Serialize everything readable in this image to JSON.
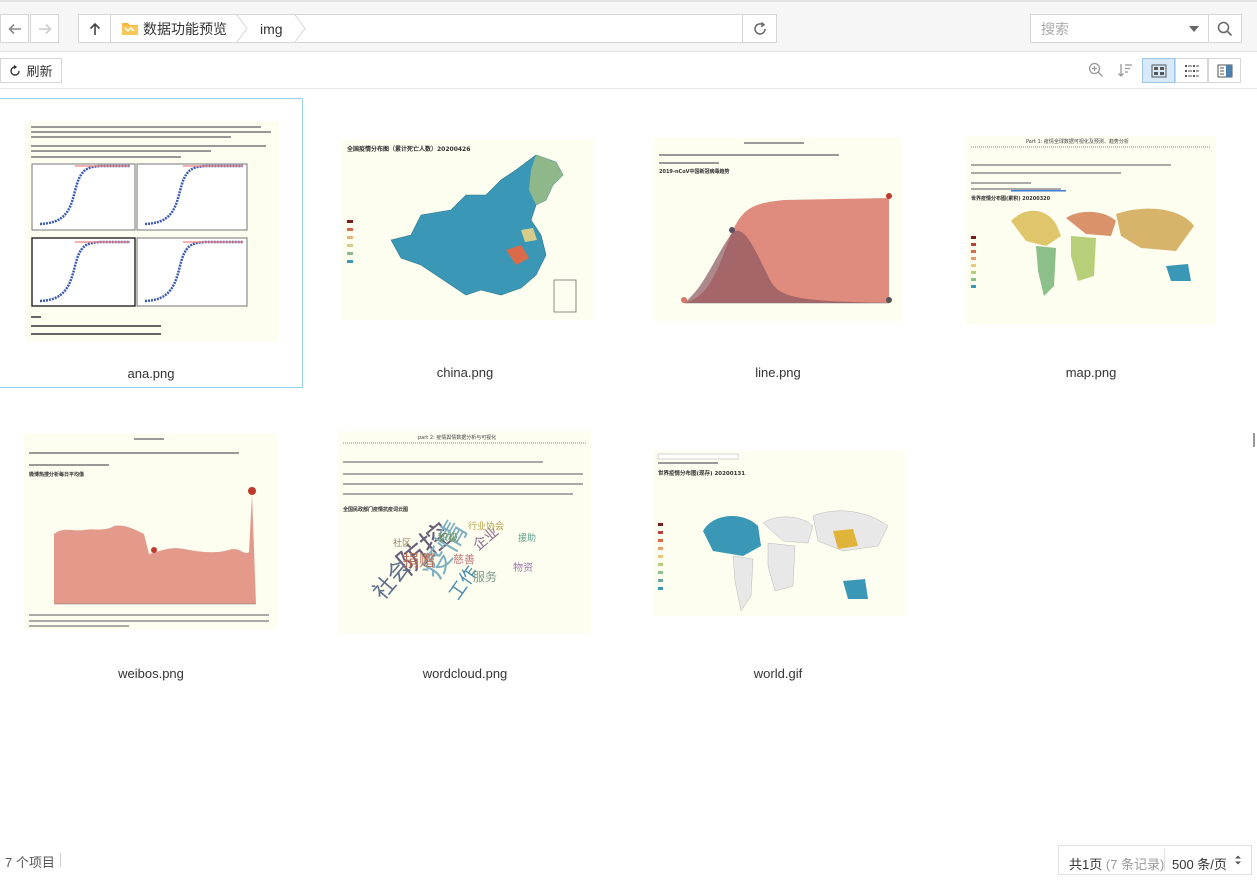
{
  "nav": {
    "path": [
      "数据功能预览",
      "img"
    ]
  },
  "search": {
    "placeholder": "搜索"
  },
  "toolbar": {
    "refresh_label": "刷新"
  },
  "files": [
    {
      "name": "ana.png",
      "selected": true
    },
    {
      "name": "china.png",
      "selected": false
    },
    {
      "name": "line.png",
      "selected": false
    },
    {
      "name": "map.png",
      "selected": false
    },
    {
      "name": "weibos.png",
      "selected": false
    },
    {
      "name": "wordcloud.png",
      "selected": false
    },
    {
      "name": "world.gif",
      "selected": false
    }
  ],
  "thumbnails": {
    "china_title": "全国疫情分布图（累计死亡人数）20200426",
    "map_title": "Part 1: 疫情全球数据可视化及预测、趋势分析",
    "map_subtitle": "世界疫情分布图(累积) 20200320",
    "world_title": "世界疫情分布图(现存) 20200131",
    "wordcloud_header": "part 2: 疫情舆情数据分析与可视化",
    "wordcloud_title": "全国民政部门疫情抗疫词云图",
    "line_title": "2019-nCoV中国新冠病毒趋势",
    "weibos_title": "微博热搜分析每日平均值",
    "wordcloud_words": [
      "防控",
      "疫情",
      "社会",
      "工作",
      "捐赠",
      "服务",
      "企业",
      "行业协会",
      "慈善",
      "积极",
      "社区",
      "物资",
      "援助"
    ],
    "legend_china": [
      "> 10000",
      "1000 - 10000",
      "500 - 999",
      "100 - 499",
      "10 - 99",
      "0 - 9"
    ]
  },
  "status": {
    "item_count": "7 个项目",
    "page_info_prefix": "共1页",
    "page_info_records": "(7 条记录)",
    "per_page": "500 条/页"
  },
  "colors": {
    "accent": "#99d1f1",
    "map_blue": "#3a97b5",
    "line_fill": "#d9786a",
    "thumb_bg": "#fdfdf0"
  }
}
